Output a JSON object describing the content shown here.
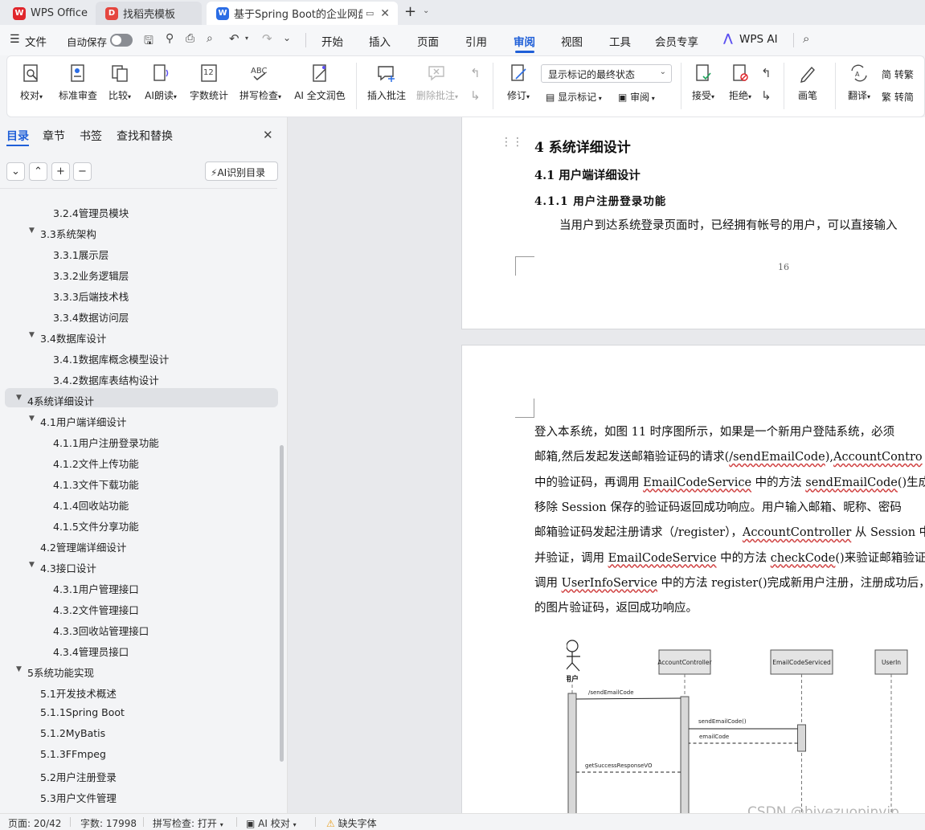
{
  "tabs": [
    {
      "label": "WPS Office",
      "icon": "wps-logo-icon",
      "color": "#e0262c"
    },
    {
      "label": "找稻壳模板",
      "icon": "docer-icon",
      "color": "#e5463f"
    },
    {
      "label": "基于Spring Boot的企业网盘",
      "icon": "writer-doc-icon",
      "color": "#2b6de5"
    }
  ],
  "menu": {
    "file": "文件",
    "autosave": "自动保存",
    "items": [
      "开始",
      "插入",
      "页面",
      "引用",
      "审阅",
      "视图",
      "工具",
      "会员专享"
    ],
    "active": "审阅",
    "ai": "WPS AI"
  },
  "ribbon": {
    "proofread": "校对",
    "standard_review": "标准审查",
    "compare": "比较",
    "ai_read": "AI朗读",
    "word_count": "字数统计",
    "spell_check": "拼写检查",
    "ai_polish": "AI 全文润色",
    "insert_comment": "插入批注",
    "delete_comment": "删除批注",
    "revise": "修订",
    "markup_select": "显示标记的最终状态",
    "show_markup": "显示标记",
    "review": "审阅",
    "accept": "接受",
    "reject": "拒绝",
    "pen": "画笔",
    "translate": "翻译",
    "to_trad": "转繁",
    "to_simp": "转简",
    "word_count_icon_text": "12",
    "spell_icon_text": "ABC"
  },
  "panel": {
    "tabs": [
      "目录",
      "章节",
      "书签",
      "查找和替换"
    ],
    "active_tab": "目录",
    "ai_toc": "AI识别目录",
    "toc": [
      {
        "label": "3.2.4管理员模块",
        "level": 3,
        "arrow": false
      },
      {
        "label": "3.3系统架构",
        "level": 2,
        "arrow": true
      },
      {
        "label": "3.3.1展示层",
        "level": 3,
        "arrow": false
      },
      {
        "label": "3.3.2业务逻辑层",
        "level": 3,
        "arrow": false
      },
      {
        "label": "3.3.3后端技术栈",
        "level": 3,
        "arrow": false
      },
      {
        "label": "3.3.4数据访问层",
        "level": 3,
        "arrow": false
      },
      {
        "label": "3.4数据库设计",
        "level": 2,
        "arrow": true
      },
      {
        "label": "3.4.1数据库概念模型设计",
        "level": 3,
        "arrow": false
      },
      {
        "label": "3.4.2数据库表结构设计",
        "level": 3,
        "arrow": false
      },
      {
        "label": "4系统详细设计",
        "level": 1,
        "arrow": true,
        "selected": true
      },
      {
        "label": "4.1用户端详细设计",
        "level": 2,
        "arrow": true
      },
      {
        "label": "4.1.1用户注册登录功能",
        "level": 3,
        "arrow": false
      },
      {
        "label": "4.1.2文件上传功能",
        "level": 3,
        "arrow": false
      },
      {
        "label": "4.1.3文件下载功能",
        "level": 3,
        "arrow": false
      },
      {
        "label": "4.1.4回收站功能",
        "level": 3,
        "arrow": false
      },
      {
        "label": "4.1.5文件分享功能",
        "level": 3,
        "arrow": false
      },
      {
        "label": "4.2管理端详细设计",
        "level": 2,
        "arrow": false
      },
      {
        "label": "4.3接口设计",
        "level": 2,
        "arrow": true
      },
      {
        "label": "4.3.1用户管理接口",
        "level": 3,
        "arrow": false
      },
      {
        "label": "4.3.2文件管理接口",
        "level": 3,
        "arrow": false
      },
      {
        "label": "4.3.3回收站管理接口",
        "level": 3,
        "arrow": false
      },
      {
        "label": "4.3.4管理员接口",
        "level": 3,
        "arrow": false
      },
      {
        "label": "5系统功能实现",
        "level": 1,
        "arrow": true
      },
      {
        "label": "5.1开发技术概述",
        "level": 2,
        "arrow": false
      },
      {
        "label": "5.1.1Spring Boot",
        "level": 2,
        "arrow": false
      },
      {
        "label": "5.1.2MyBatis",
        "level": 2,
        "arrow": false
      },
      {
        "label": "5.1.3FFmpeg",
        "level": 2,
        "arrow": false
      },
      {
        "label": "5.2用户注册登录",
        "level": 2,
        "arrow": false
      },
      {
        "label": "5.3用户文件管理",
        "level": 2,
        "arrow": false
      }
    ]
  },
  "document": {
    "h1": "4  系统详细设计",
    "h2": "4.1  用户端详细设计",
    "h3": "4.1.1  用户注册登录功能",
    "p1": "当用户到达系统登录页面时，已经拥有帐号的用户，可以直接输入",
    "page_number": "16",
    "lines": [
      [
        {
          "t": "登入本系统，如图 11 时序图所示，如果是一个新用户登陆系统，必须"
        }
      ],
      [
        {
          "t": "邮箱,然后发起发送邮箱验证码的请求("
        },
        {
          "t": "/sendEmailCode",
          "w": true
        },
        {
          "t": "),"
        },
        {
          "t": "AccountContro",
          "w": true
        }
      ],
      [
        {
          "t": "中的验证码，再调用 "
        },
        {
          "t": "EmailCodeService",
          "w": true
        },
        {
          "t": " 中的方法 "
        },
        {
          "t": "sendEmailCode",
          "w": true
        },
        {
          "t": "()生成"
        }
      ],
      [
        {
          "t": "移除 Session 保存的验证码返回成功响应。用户输入邮箱、昵称、密码"
        }
      ],
      [
        {
          "t": "邮箱验证码发起注册请求（/register），"
        },
        {
          "t": "AccountController",
          "w": true
        },
        {
          "t": " 从 Session 中"
        }
      ],
      [
        {
          "t": "并验证，调用 "
        },
        {
          "t": "EmailCodeService",
          "w": true
        },
        {
          "t": " 中的方法 "
        },
        {
          "t": "checkCode",
          "w": true
        },
        {
          "t": "()来验证邮箱验证"
        }
      ],
      [
        {
          "t": "调用 "
        },
        {
          "t": "UserInfoService",
          "w": true
        },
        {
          "t": " 中的方法 register()完成新用户注册，注册成功后，"
        }
      ],
      [
        {
          "t": "的图片验证码，返回成功响应。"
        }
      ]
    ],
    "diagram": {
      "actor": "用户",
      "lifelines": [
        "AccountController",
        "EmailCodeServiced",
        "UserIn"
      ],
      "messages": [
        "/sendEmailCode",
        "sendEmailCode()",
        "emailCode",
        "getSuccessResponseVO"
      ]
    }
  },
  "status": {
    "page": "页面: 20/42",
    "words": "字数: 17998",
    "spell": "拼写检查: 打开",
    "ai_check": "AI 校对",
    "missing_font": "缺失字体"
  },
  "watermark": "CSDN @biyezuopinvip"
}
